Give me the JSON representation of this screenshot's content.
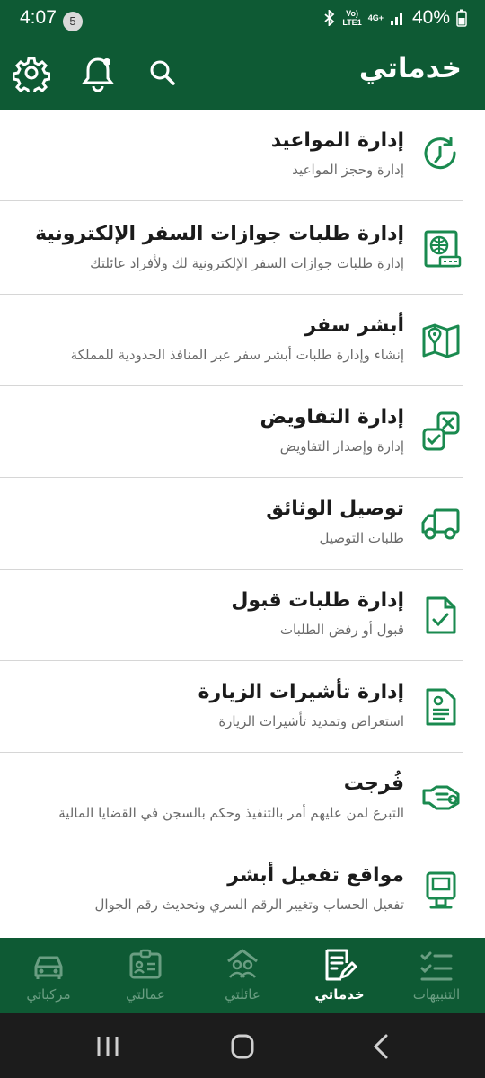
{
  "status": {
    "time": "4:07",
    "notification_count": "5",
    "network_top": "Vo)",
    "network_bottom": "LTE1",
    "signal_label": "4G+",
    "battery": "40%"
  },
  "header": {
    "title": "خدماتي",
    "icons": [
      "settings-icon",
      "bell-icon",
      "search-icon"
    ]
  },
  "services": [
    {
      "title": "إدارة المواعيد",
      "subtitle": "إدارة وحجز المواعيد",
      "icon": "clock-refresh-icon"
    },
    {
      "title": "إدارة طلبات جوازات السفر الإلكترونية",
      "subtitle": "إدارة طلبات جوازات السفر الإلكترونية لك ولأفراد عائلتك",
      "icon": "passport-icon"
    },
    {
      "title": "أبشر سفر",
      "subtitle": "إنشاء وإدارة طلبات أبشر سفر عبر المنافذ الحدودية للمملكة",
      "icon": "map-icon"
    },
    {
      "title": "إدارة التفاويض",
      "subtitle": "إدارة وإصدار التفاويض",
      "icon": "delegation-icon"
    },
    {
      "title": "توصيل الوثائق",
      "subtitle": "طلبات التوصيل",
      "icon": "truck-icon"
    },
    {
      "title": "إدارة طلبات قبول",
      "subtitle": "قبول أو رفض الطلبات",
      "icon": "document-check-icon"
    },
    {
      "title": "إدارة تأشيرات الزيارة",
      "subtitle": "استعراض وتمديد تأشيرات الزيارة",
      "icon": "visa-document-icon"
    },
    {
      "title": "فُرجت",
      "subtitle": "التبرع لمن عليهم أمر بالتنفيذ وحكم بالسجن في القضايا المالية",
      "icon": "handshake-icon"
    },
    {
      "title": "مواقع تفعيل أبشر",
      "subtitle": "تفعيل الحساب وتغيير الرقم السري وتحديث رقم الجوال",
      "icon": "kiosk-icon"
    }
  ],
  "bottom_nav": [
    {
      "label": "مركباتي",
      "icon": "car-icon",
      "active": false
    },
    {
      "label": "عمالتي",
      "icon": "id-card-icon",
      "active": false
    },
    {
      "label": "عائلتي",
      "icon": "family-icon",
      "active": false
    },
    {
      "label": "خدماتي",
      "icon": "services-edit-icon",
      "active": true
    },
    {
      "label": "التنبيهات",
      "icon": "checklist-icon",
      "active": false
    }
  ],
  "colors": {
    "primary": "#0e5a34",
    "accent": "#1a8a4f",
    "inactive_nav": "#6a9e82"
  }
}
